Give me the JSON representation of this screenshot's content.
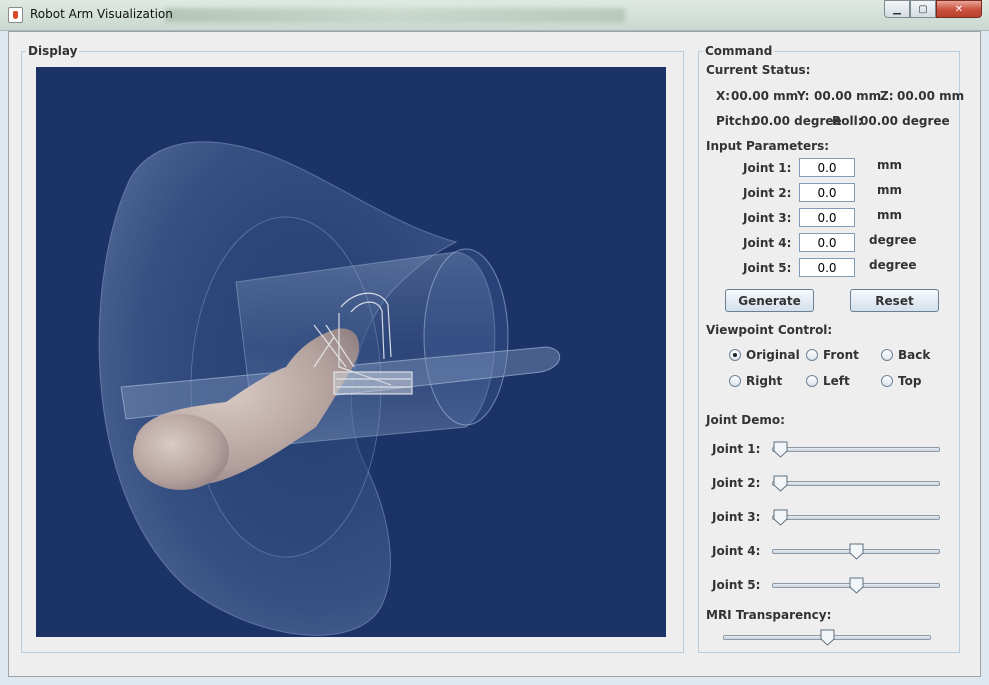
{
  "window": {
    "title": "Robot Arm Visualization",
    "minimize_glyph": "▁",
    "maximize_glyph": "▢",
    "close_glyph": "✕"
  },
  "display": {
    "title": "Display",
    "background_color": "#1c3368"
  },
  "command": {
    "title": "Command",
    "current_status": {
      "heading": "Current Status:",
      "x_label": "X:",
      "x_value": "00.00 mm",
      "y_label": "Y:",
      "y_value": "00.00 mm",
      "z_label": "Z:",
      "z_value": "00.00 mm",
      "pitch_label": "Pitch:",
      "pitch_value": "00.00 degree",
      "roll_label": "Roll:",
      "roll_value": "00.00 degree"
    },
    "input_parameters": {
      "heading": "Input Parameters:",
      "joints": [
        {
          "label": "Joint 1:",
          "value": "0.0",
          "unit": "mm"
        },
        {
          "label": "Joint 2:",
          "value": "0.0",
          "unit": "mm"
        },
        {
          "label": "Joint 3:",
          "value": "0.0",
          "unit": "mm"
        },
        {
          "label": "Joint 4:",
          "value": "0.0",
          "unit": "degree"
        },
        {
          "label": "Joint 5:",
          "value": "0.0",
          "unit": "degree"
        }
      ],
      "generate_label": "Generate",
      "reset_label": "Reset"
    },
    "viewpoint": {
      "heading": "Viewpoint Control:",
      "options": [
        {
          "label": "Original",
          "selected": true
        },
        {
          "label": "Front",
          "selected": false
        },
        {
          "label": "Back",
          "selected": false
        },
        {
          "label": "Right",
          "selected": false
        },
        {
          "label": "Left",
          "selected": false
        },
        {
          "label": "Top",
          "selected": false
        }
      ]
    },
    "joint_demo": {
      "heading": "Joint Demo:",
      "sliders": [
        {
          "label": "Joint 1:",
          "position": 0.0
        },
        {
          "label": "Joint 2:",
          "position": 0.0
        },
        {
          "label": "Joint 3:",
          "position": 0.0
        },
        {
          "label": "Joint 4:",
          "position": 0.5
        },
        {
          "label": "Joint 5:",
          "position": 0.5
        }
      ]
    },
    "mri_transparency": {
      "heading": "MRI Transparency:",
      "position": 0.5
    }
  }
}
